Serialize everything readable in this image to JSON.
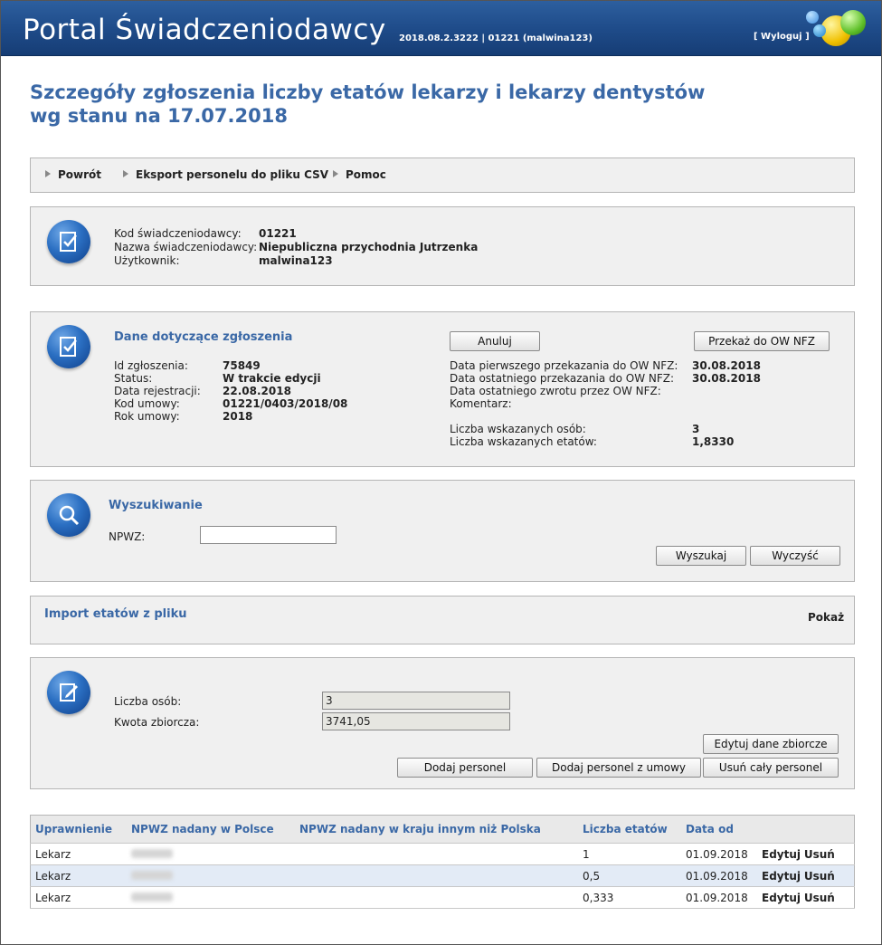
{
  "header": {
    "app_title": "Portal Świadczeniodawcy",
    "version_info": "2018.08.2.3222 | 01221 (malwina123)",
    "logout_label": "[ Wyloguj ]"
  },
  "page_title_line1": "Szczegóły zgłoszenia liczby etatów lekarzy i lekarzy dentystów",
  "page_title_line2": "wg stanu na 17.07.2018",
  "nav": {
    "back": "Powrót",
    "export_csv": "Eksport personelu do pliku CSV",
    "help": "Pomoc"
  },
  "provider": {
    "code_label": "Kod świadczeniodawcy:",
    "code_value": "01221",
    "name_label": "Nazwa świadczeniodawcy:",
    "name_value": "Niepubliczna przychodnia Jutrzenka",
    "user_label": "Użytkownik:",
    "user_value": "malwina123"
  },
  "report": {
    "title": "Dane dotyczące zgłoszenia",
    "cancel_button": "Anuluj",
    "send_button": "Przekaż do OW NFZ",
    "id_label": "Id zgłoszenia:",
    "id_value": "75849",
    "status_label": "Status:",
    "status_value": "W trakcie edycji",
    "reg_date_label": "Data rejestracji:",
    "reg_date_value": "22.08.2018",
    "contract_label": "Kod umowy:",
    "contract_value": "01221/0403/2018/08",
    "year_label": "Rok umowy:",
    "year_value": "2018",
    "first_sent_label": "Data pierwszego przekazania do OW NFZ:",
    "first_sent_value": "30.08.2018",
    "last_sent_label": "Data ostatniego przekazania do OW NFZ:",
    "last_sent_value": "30.08.2018",
    "last_return_label": "Data ostatniego zwrotu przez OW NFZ:",
    "comment_label": "Komentarz:",
    "persons_label": "Liczba wskazanych osób:",
    "persons_value": "3",
    "fte_label": "Liczba wskazanych etatów:",
    "fte_value": "1,8330"
  },
  "search": {
    "title": "Wyszukiwanie",
    "npwz_label": "NPWZ:",
    "npwz_value": "",
    "search_button": "Wyszukaj",
    "clear_button": "Wyczyść"
  },
  "import": {
    "title": "Import etatów z pliku",
    "show_label": "Pokaż"
  },
  "summary": {
    "persons_label": "Liczba osób:",
    "persons_value": "3",
    "amount_label": "Kwota zbiorcza:",
    "amount_value": "3741,05",
    "edit_summary_button": "Edytuj dane zbiorcze",
    "add_staff_button": "Dodaj personel",
    "add_staff_contract_button": "Dodaj personel z umowy",
    "remove_all_button": "Usuń cały personel"
  },
  "table": {
    "headers": [
      "Uprawnienie",
      "NPWZ nadany w Polsce",
      "NPWZ nadany w kraju innym niż Polska",
      "Liczba etatów",
      "Data od",
      ""
    ],
    "rows": [
      {
        "role": "Lekarz",
        "fte": "1",
        "date": "01.09.2018",
        "edit": "Edytuj",
        "delete": "Usuń"
      },
      {
        "role": "Lekarz",
        "fte": "0,5",
        "date": "01.09.2018",
        "edit": "Edytuj",
        "delete": "Usuń"
      },
      {
        "role": "Lekarz",
        "fte": "0,333",
        "date": "01.09.2018",
        "edit": "Edytuj",
        "delete": "Usuń"
      }
    ]
  },
  "colors": {
    "header_blue": "#1f4c8a",
    "title_blue": "#3a68a6",
    "panel_bg": "#f0f0f0",
    "row_highlight": "#e3ebf6"
  },
  "icons": [
    "document-check-icon",
    "magnifier-icon",
    "edit-document-icon",
    "logo-balls-icon"
  ]
}
